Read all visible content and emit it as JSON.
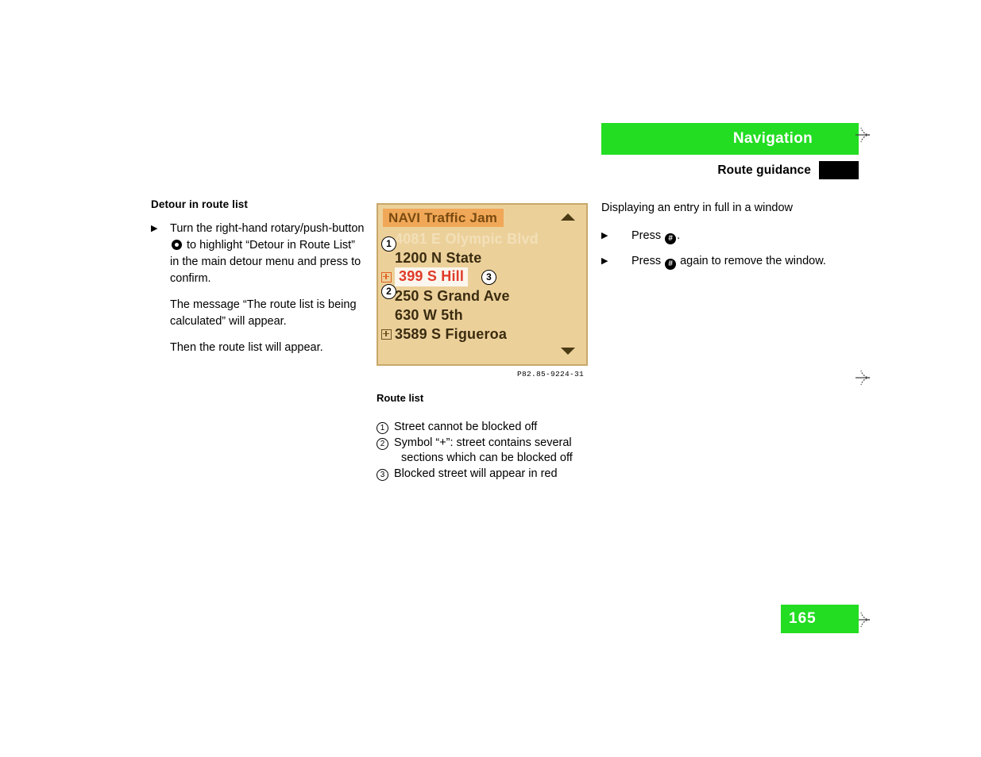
{
  "header": {
    "title": "Navigation",
    "subtitle": "Route guidance",
    "thumb_index": "",
    "green_hex": "#22dd22"
  },
  "left": {
    "heading": "Detour in route list",
    "bullet": {
      "arrow": "▶",
      "text_before_icon": "Turn the right-hand rotary/push-button ",
      "icon_name": "rotary-push-button-icon",
      "text_after_icon": " to highlight “Detour in Route List” in the main detour menu and press to confirm."
    },
    "para_1": "The message “The route list is being calculated” will appear.",
    "para_2": "Then the route list will appear."
  },
  "figure": {
    "screen_title": "NAVI Traffic Jam",
    "scroll_up_icon": "scroll-up-arrow",
    "scroll_down_icon": "scroll-down-arrow",
    "rows": [
      {
        "plus": "none",
        "label": "4081 E Olympic Blvd",
        "style": "dimmed"
      },
      {
        "plus": "none",
        "label": "1200 N State",
        "style": "normal"
      },
      {
        "plus": "orange",
        "label": "399 S Hill",
        "style": "blocked"
      },
      {
        "plus": "none",
        "label": "250 S Grand Ave",
        "style": "normal"
      },
      {
        "plus": "none",
        "label": "630 W 5th",
        "style": "normal"
      },
      {
        "plus": "brown",
        "label": "3589 S Figueroa",
        "style": "normal"
      }
    ],
    "callouts": [
      "1",
      "2",
      "3"
    ],
    "code": "P82.85-9224-31",
    "caption": "Route list",
    "legend": [
      {
        "marker": "1",
        "text": "Street cannot be blocked off",
        "cont": ""
      },
      {
        "marker": "2",
        "text": "Symbol “+”: street contains several",
        "cont": "sections which can be blocked off"
      },
      {
        "marker": "3",
        "text": "Blocked street will appear in red",
        "cont": ""
      }
    ],
    "colors": {
      "screen_bg": "#ecd09a",
      "screen_border": "#c8a86a",
      "title_bar": "#f0a858",
      "blocked_text": "#e03a28",
      "plus_orange": "#e06424",
      "plus_brown": "#6e5222"
    }
  },
  "right": {
    "intro": "Displaying an entry in full in a window",
    "bullets": [
      {
        "arrow": "▶",
        "before": "Press ",
        "icon": "hash-key-icon",
        "glyph": "#",
        "after": "."
      },
      {
        "arrow": "▶",
        "before": "Press ",
        "icon": "hash-key-icon",
        "glyph": "#",
        "after": " again to remove the window."
      }
    ]
  },
  "footer": {
    "page_number": "165"
  }
}
